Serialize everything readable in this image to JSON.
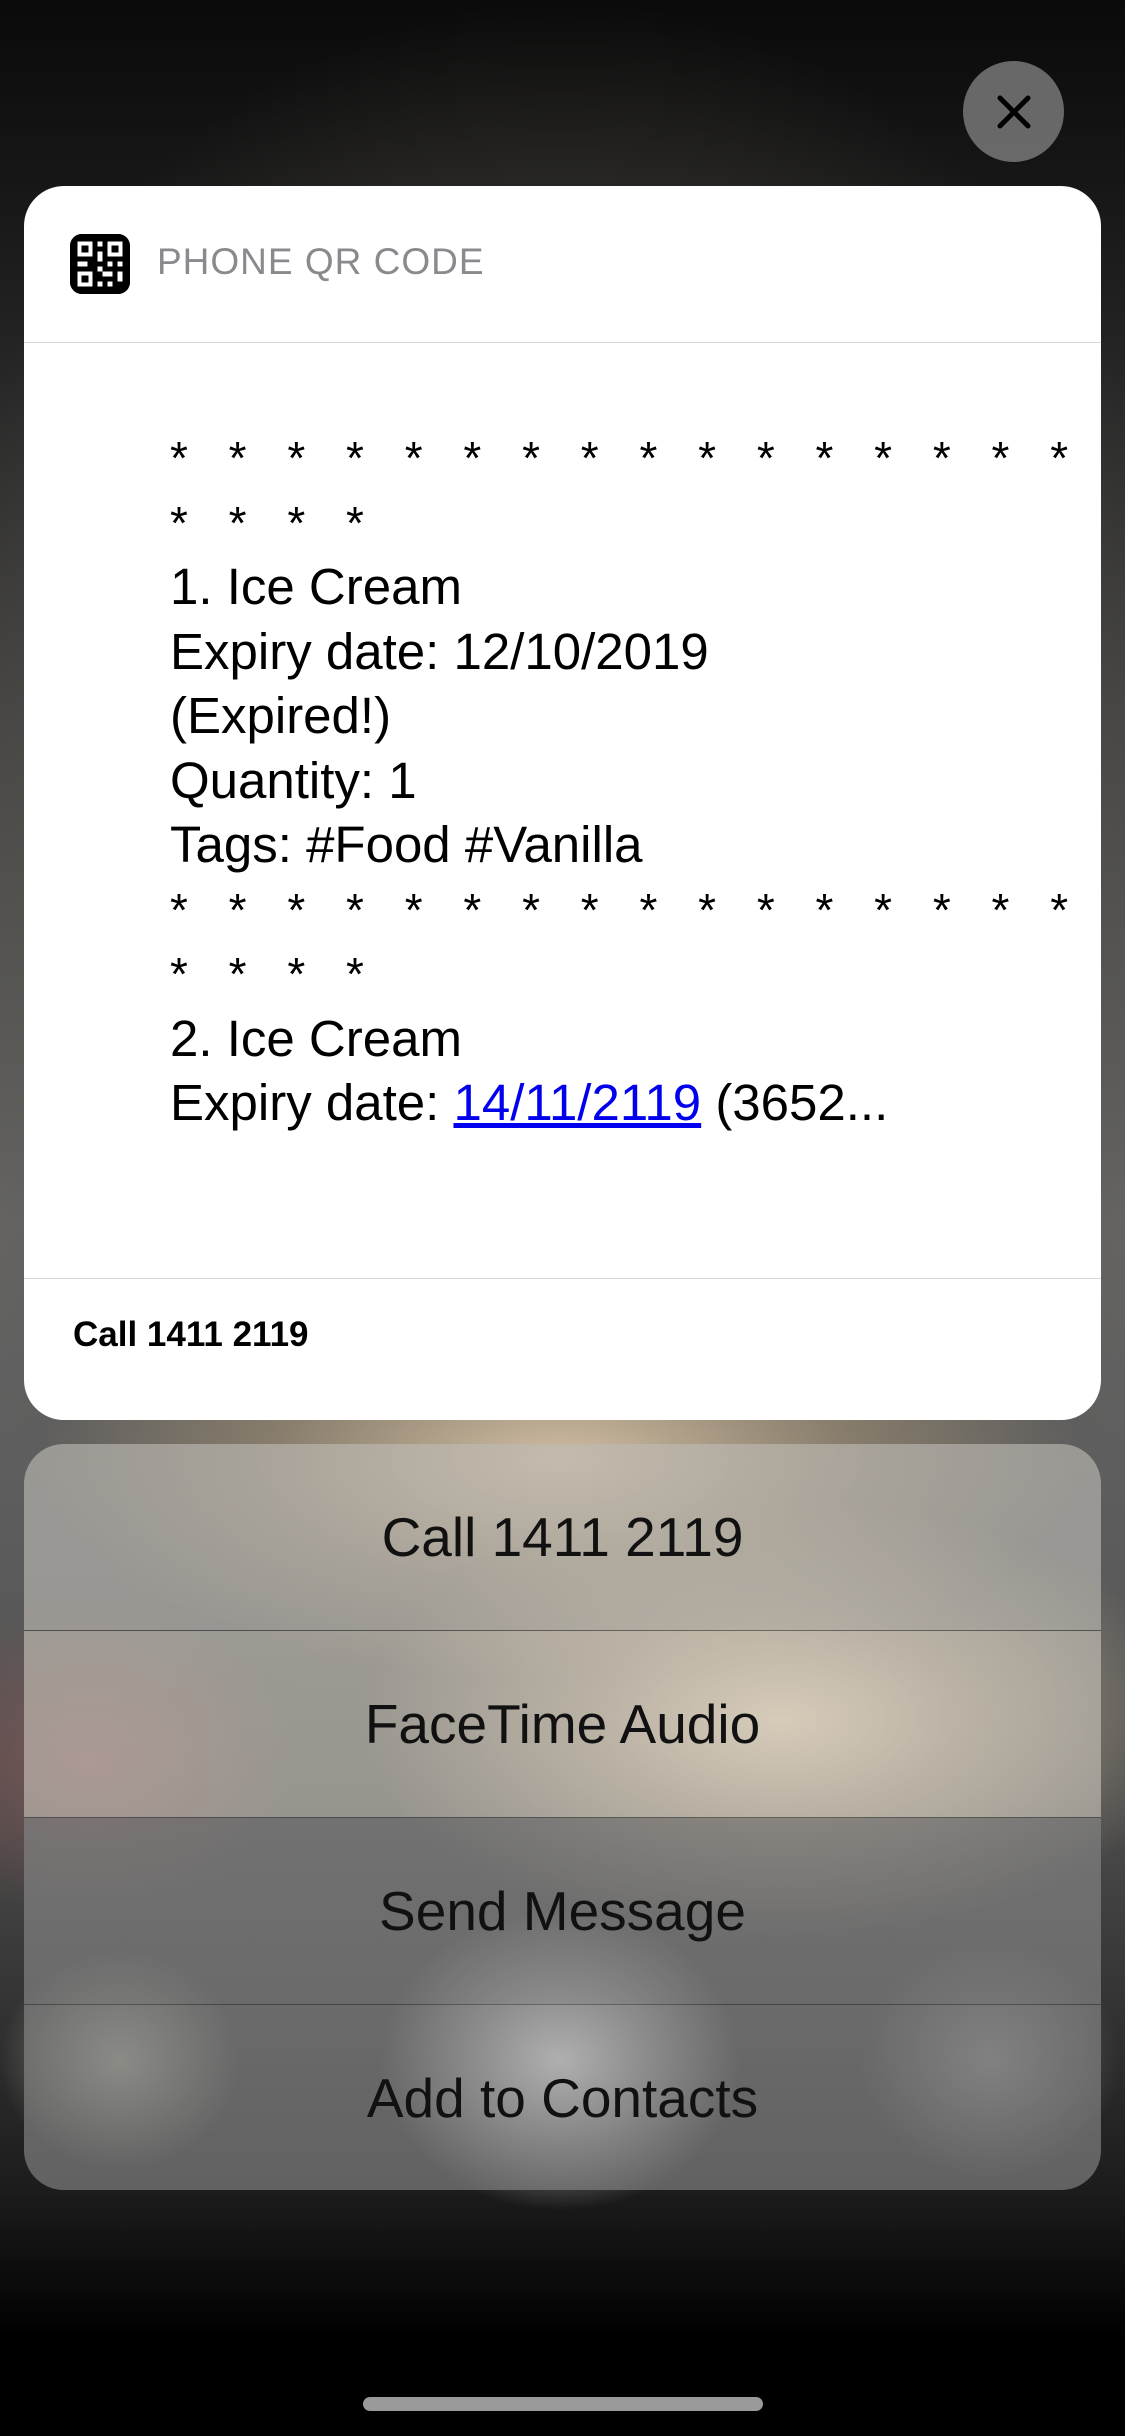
{
  "close_button": {
    "icon": "close-icon",
    "label": "Close"
  },
  "notification": {
    "app_name": "PHONE QR CODE",
    "app_icon": "qr-code-icon",
    "body": {
      "stars_1": "* * * * * * * * * * * * * * * * * * * * *",
      "stars_1b": "* * * *",
      "item1_name": "1. Ice Cream",
      "item1_expiry": "Expiry date: 12/10/2019",
      "item1_status": "(Expired!)",
      "item1_quantity": "Quantity: 1",
      "item1_tags": "Tags: #Food #Vanilla",
      "stars_2": "* * * * * * * * * * * * * * * * * * * * *",
      "stars_2b": "* * * *",
      "item2_name": "2. Ice Cream",
      "item2_expiry_prefix": "Expiry date: ",
      "item2_expiry_link": "14/11/2119",
      "item2_expiry_suffix": " (3652..."
    },
    "footer": "Call 1411 2119"
  },
  "actions": [
    {
      "label": "Call 1411 2119"
    },
    {
      "label": "FaceTime Audio"
    },
    {
      "label": "Send Message"
    },
    {
      "label": "Add to Contacts"
    }
  ],
  "colors": {
    "link": "#0000ee",
    "card_bg": "#ffffff",
    "header_text": "#8a8a8e"
  }
}
